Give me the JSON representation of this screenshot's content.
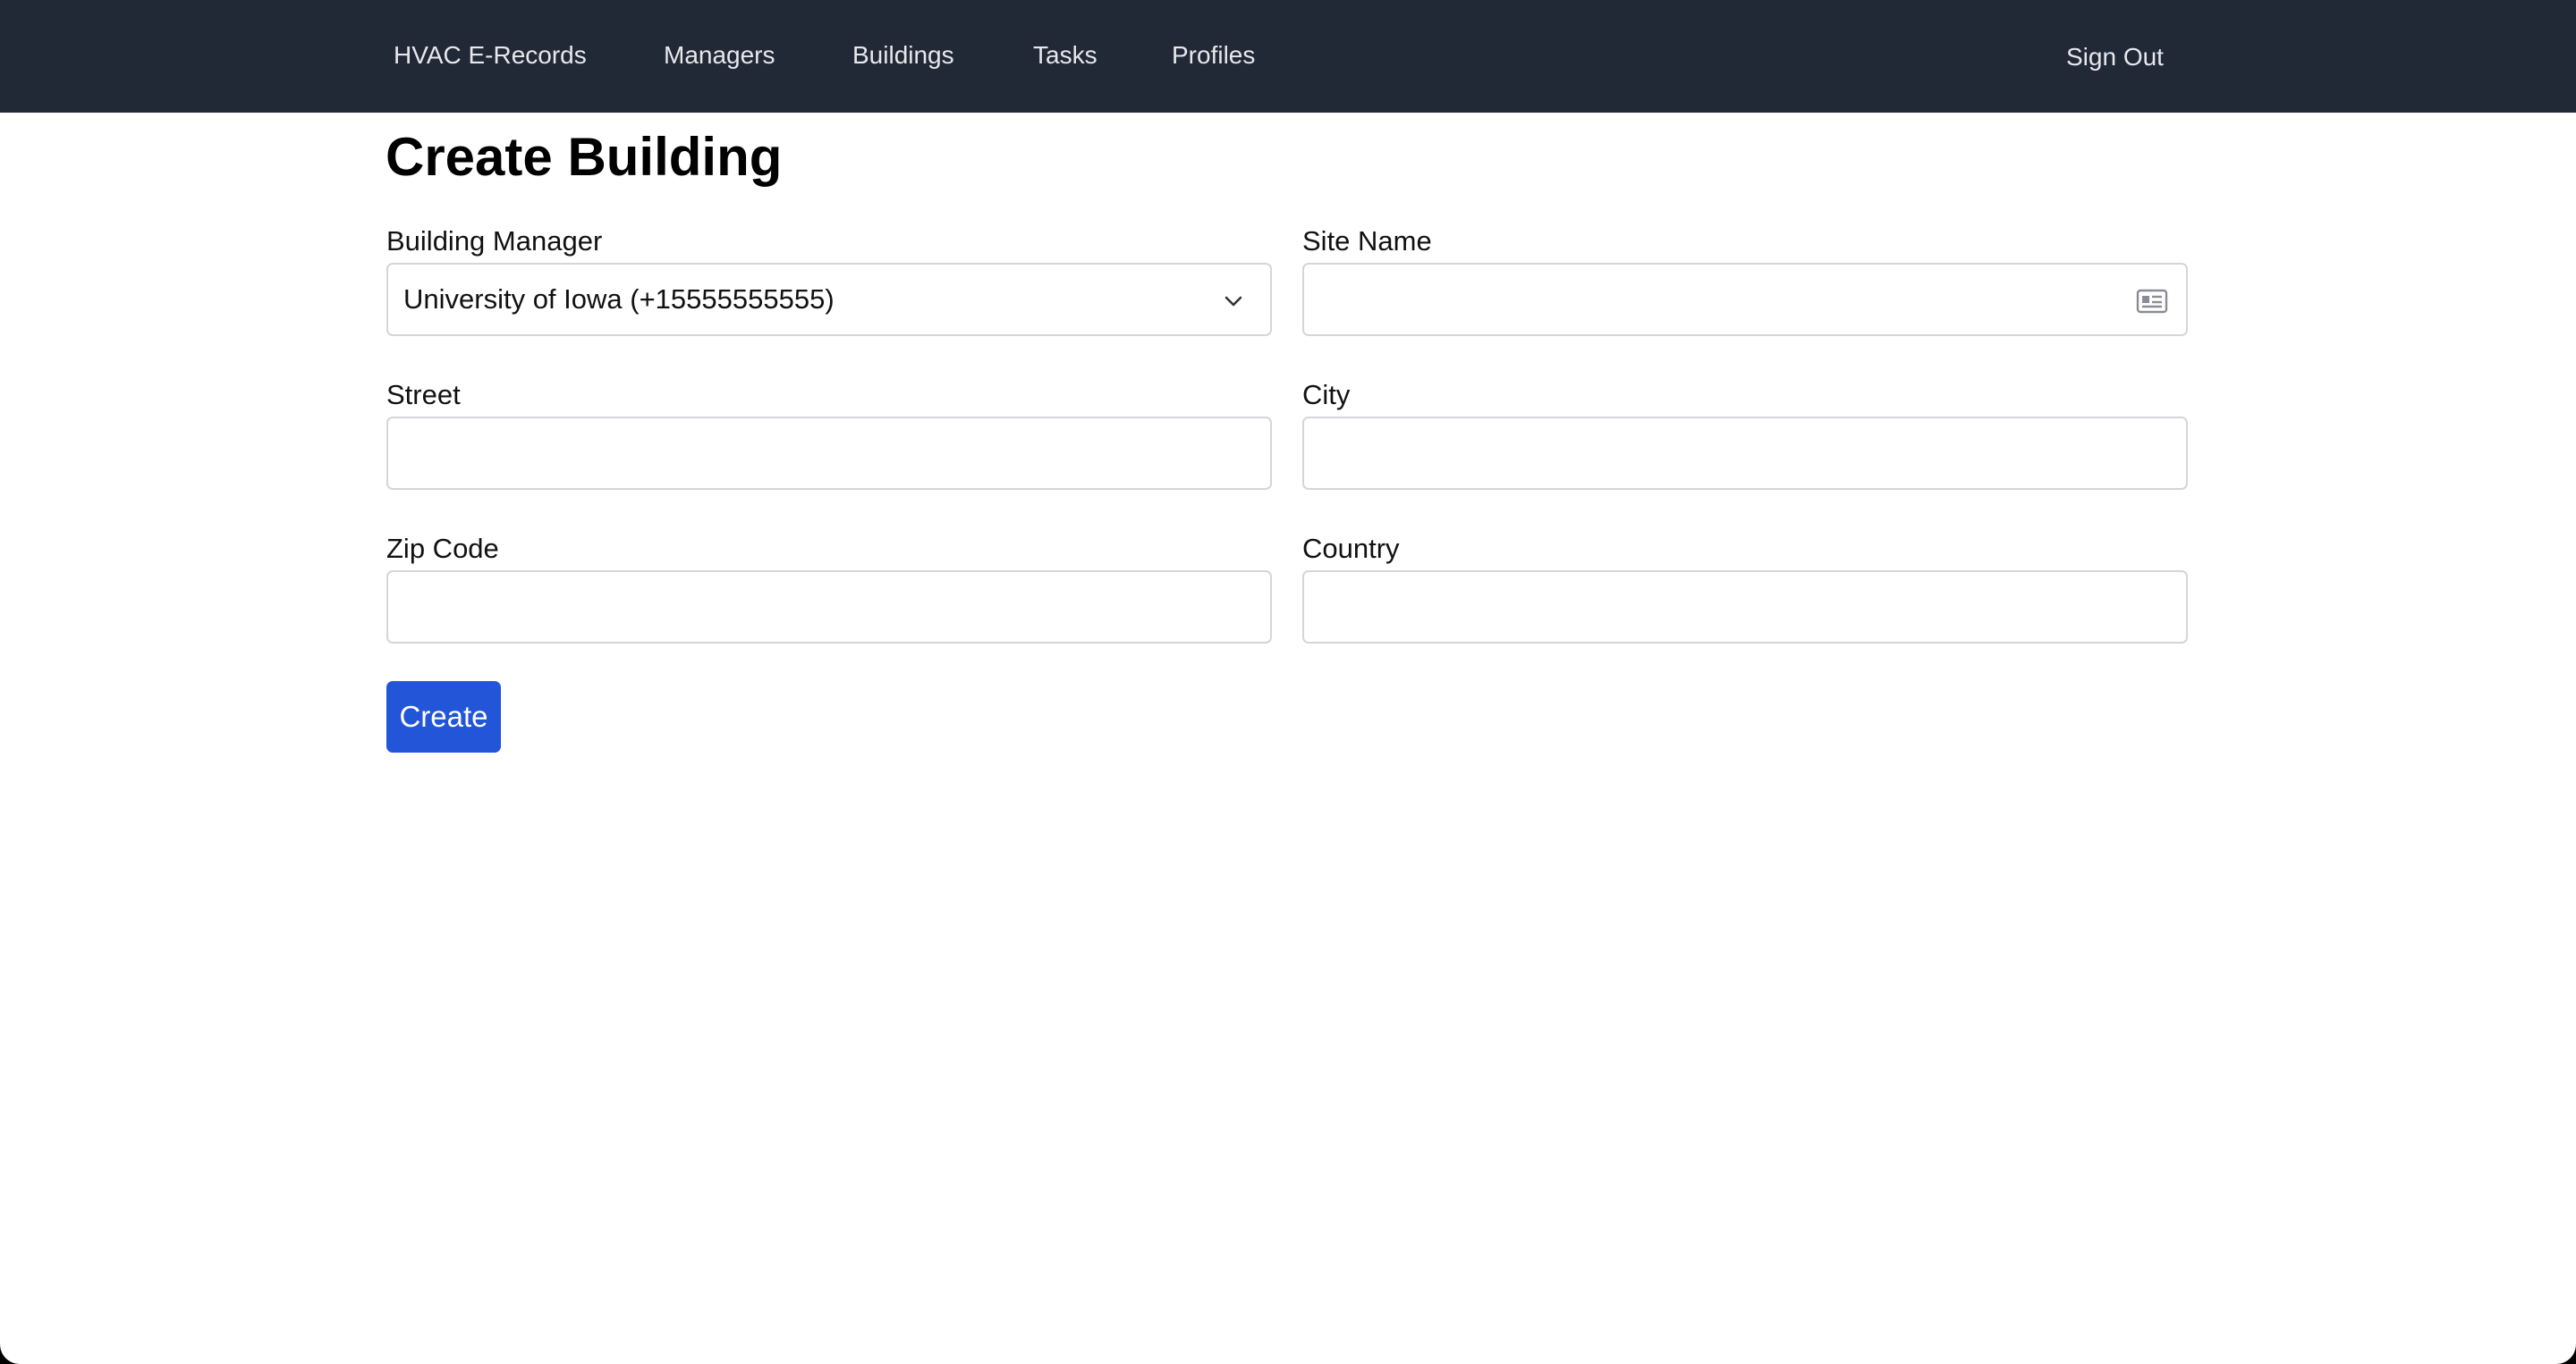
{
  "nav": {
    "brand": "HVAC E-Records",
    "links": [
      "Managers",
      "Buildings",
      "Tasks",
      "Profiles"
    ],
    "sign_out": "Sign Out"
  },
  "page": {
    "title": "Create Building"
  },
  "form": {
    "building_manager": {
      "label": "Building Manager",
      "selected": "University of Iowa (+15555555555)"
    },
    "site_name": {
      "label": "Site Name",
      "value": ""
    },
    "street": {
      "label": "Street",
      "value": ""
    },
    "city": {
      "label": "City",
      "value": ""
    },
    "zip_code": {
      "label": "Zip Code",
      "value": ""
    },
    "country": {
      "label": "Country",
      "value": ""
    },
    "submit_label": "Create"
  },
  "colors": {
    "navbar_bg": "#212836",
    "primary_button": "#2355d8"
  },
  "icons": {
    "select_caret": "chevron-down-icon",
    "site_name_autofill": "contact-card-icon"
  }
}
